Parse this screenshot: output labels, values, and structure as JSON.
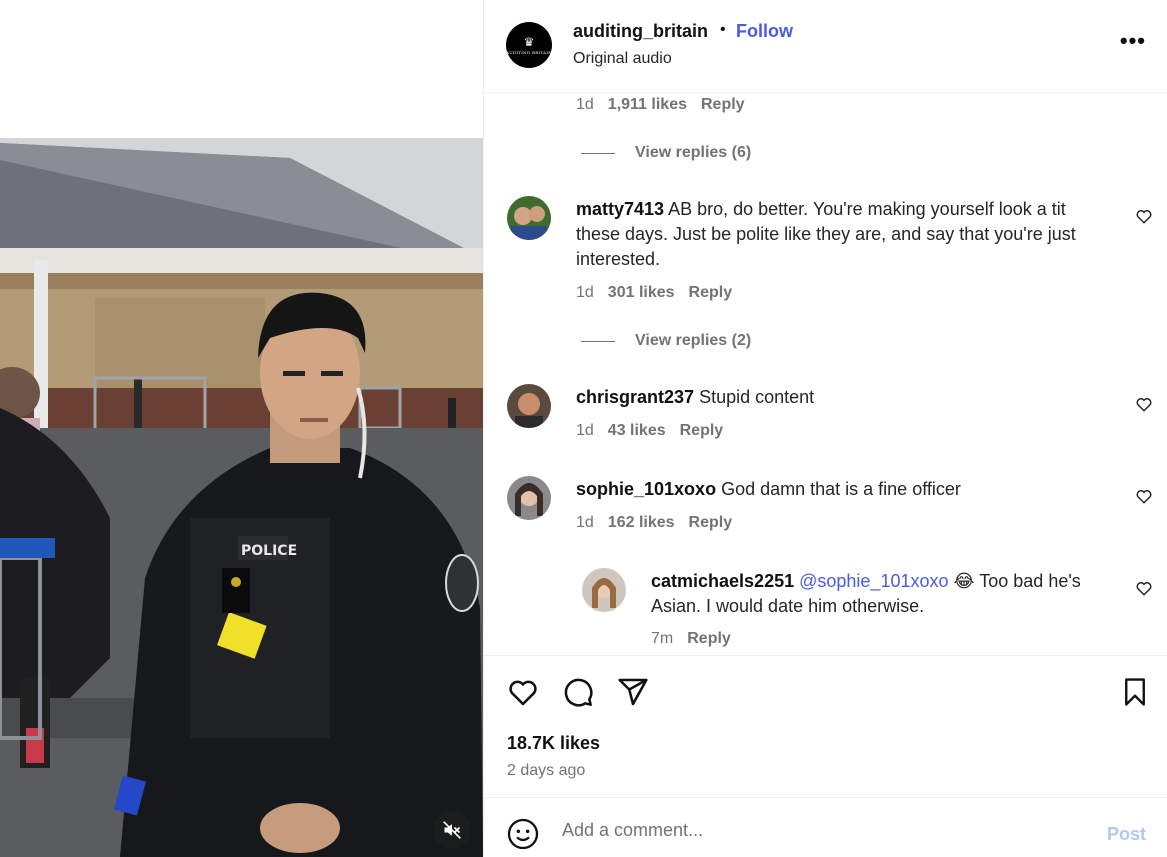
{
  "header": {
    "avatar_text": "AUDITING BRITAIN",
    "username": "auditing_britain",
    "separator": "•",
    "follow_label": "Follow",
    "audio_label": "Original audio",
    "more_label": "•••"
  },
  "video": {
    "patch_text": "POLICE",
    "muted": true
  },
  "comments": {
    "top_meta": {
      "time": "1d",
      "likes": "1,911 likes",
      "reply": "Reply"
    },
    "view_replies_1": "View replies (6)",
    "items": [
      {
        "username": "matty7413",
        "text": "AB bro, do better. You're making yourself look a tit these days. Just be polite like they are, and say that you're just interested.",
        "time": "1d",
        "likes": "301 likes",
        "reply": "Reply"
      },
      {
        "username": "chrisgrant237",
        "text": "Stupid content",
        "time": "1d",
        "likes": "43 likes",
        "reply": "Reply"
      },
      {
        "username": "sophie_101xoxo",
        "text": "God damn that is a fine officer",
        "time": "1d",
        "likes": "162 likes",
        "reply": "Reply"
      }
    ],
    "view_replies_2": "View replies (2)",
    "reply": {
      "username": "catmichaels2251",
      "mention": "@sophie_101xoxo",
      "emoji": "😂",
      "text": "Too bad he's Asian. I would date him otherwise.",
      "time": "7m",
      "reply": "Reply"
    }
  },
  "actions": {
    "likes": "18.7K likes",
    "date": "2 days ago"
  },
  "composer": {
    "placeholder": "Add a comment...",
    "post_label": "Post"
  }
}
